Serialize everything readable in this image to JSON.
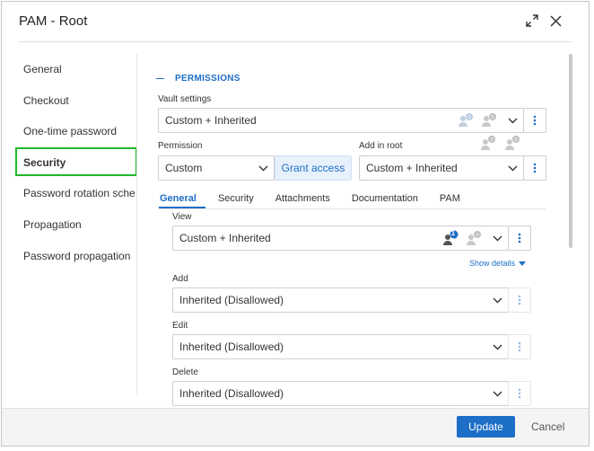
{
  "dialog": {
    "title": "PAM - Root"
  },
  "nav": {
    "items": [
      {
        "label": "General"
      },
      {
        "label": "Checkout"
      },
      {
        "label": "One-time password"
      },
      {
        "label": "Security"
      },
      {
        "label": "Password rotation sche..."
      },
      {
        "label": "Propagation"
      },
      {
        "label": "Password propagation"
      }
    ],
    "active_index": 3
  },
  "permissions": {
    "section_title": "PERMISSIONS",
    "vault_settings": {
      "label": "Vault settings",
      "value": "Custom + Inherited"
    },
    "permission": {
      "label": "Permission",
      "value": "Custom"
    },
    "grant_label": "Grant access",
    "add_in_root": {
      "label": "Add in root",
      "value": "Custom + Inherited"
    }
  },
  "tabs": [
    {
      "label": "General"
    },
    {
      "label": "Security"
    },
    {
      "label": "Attachments"
    },
    {
      "label": "Documentation"
    },
    {
      "label": "PAM"
    }
  ],
  "general": {
    "view": {
      "label": "View",
      "value": "Custom + Inherited",
      "badge_count": "1"
    },
    "show_details": "Show details",
    "add": {
      "label": "Add",
      "value": "Inherited (Disallowed)"
    },
    "edit": {
      "label": "Edit",
      "value": "Inherited (Disallowed)"
    },
    "delete": {
      "label": "Delete",
      "value": "Inherited (Disallowed)"
    }
  },
  "footer": {
    "update_label": "Update",
    "cancel_label": "Cancel"
  },
  "colors": {
    "accent": "#1c6ec7",
    "highlight": "#1fb82a"
  }
}
